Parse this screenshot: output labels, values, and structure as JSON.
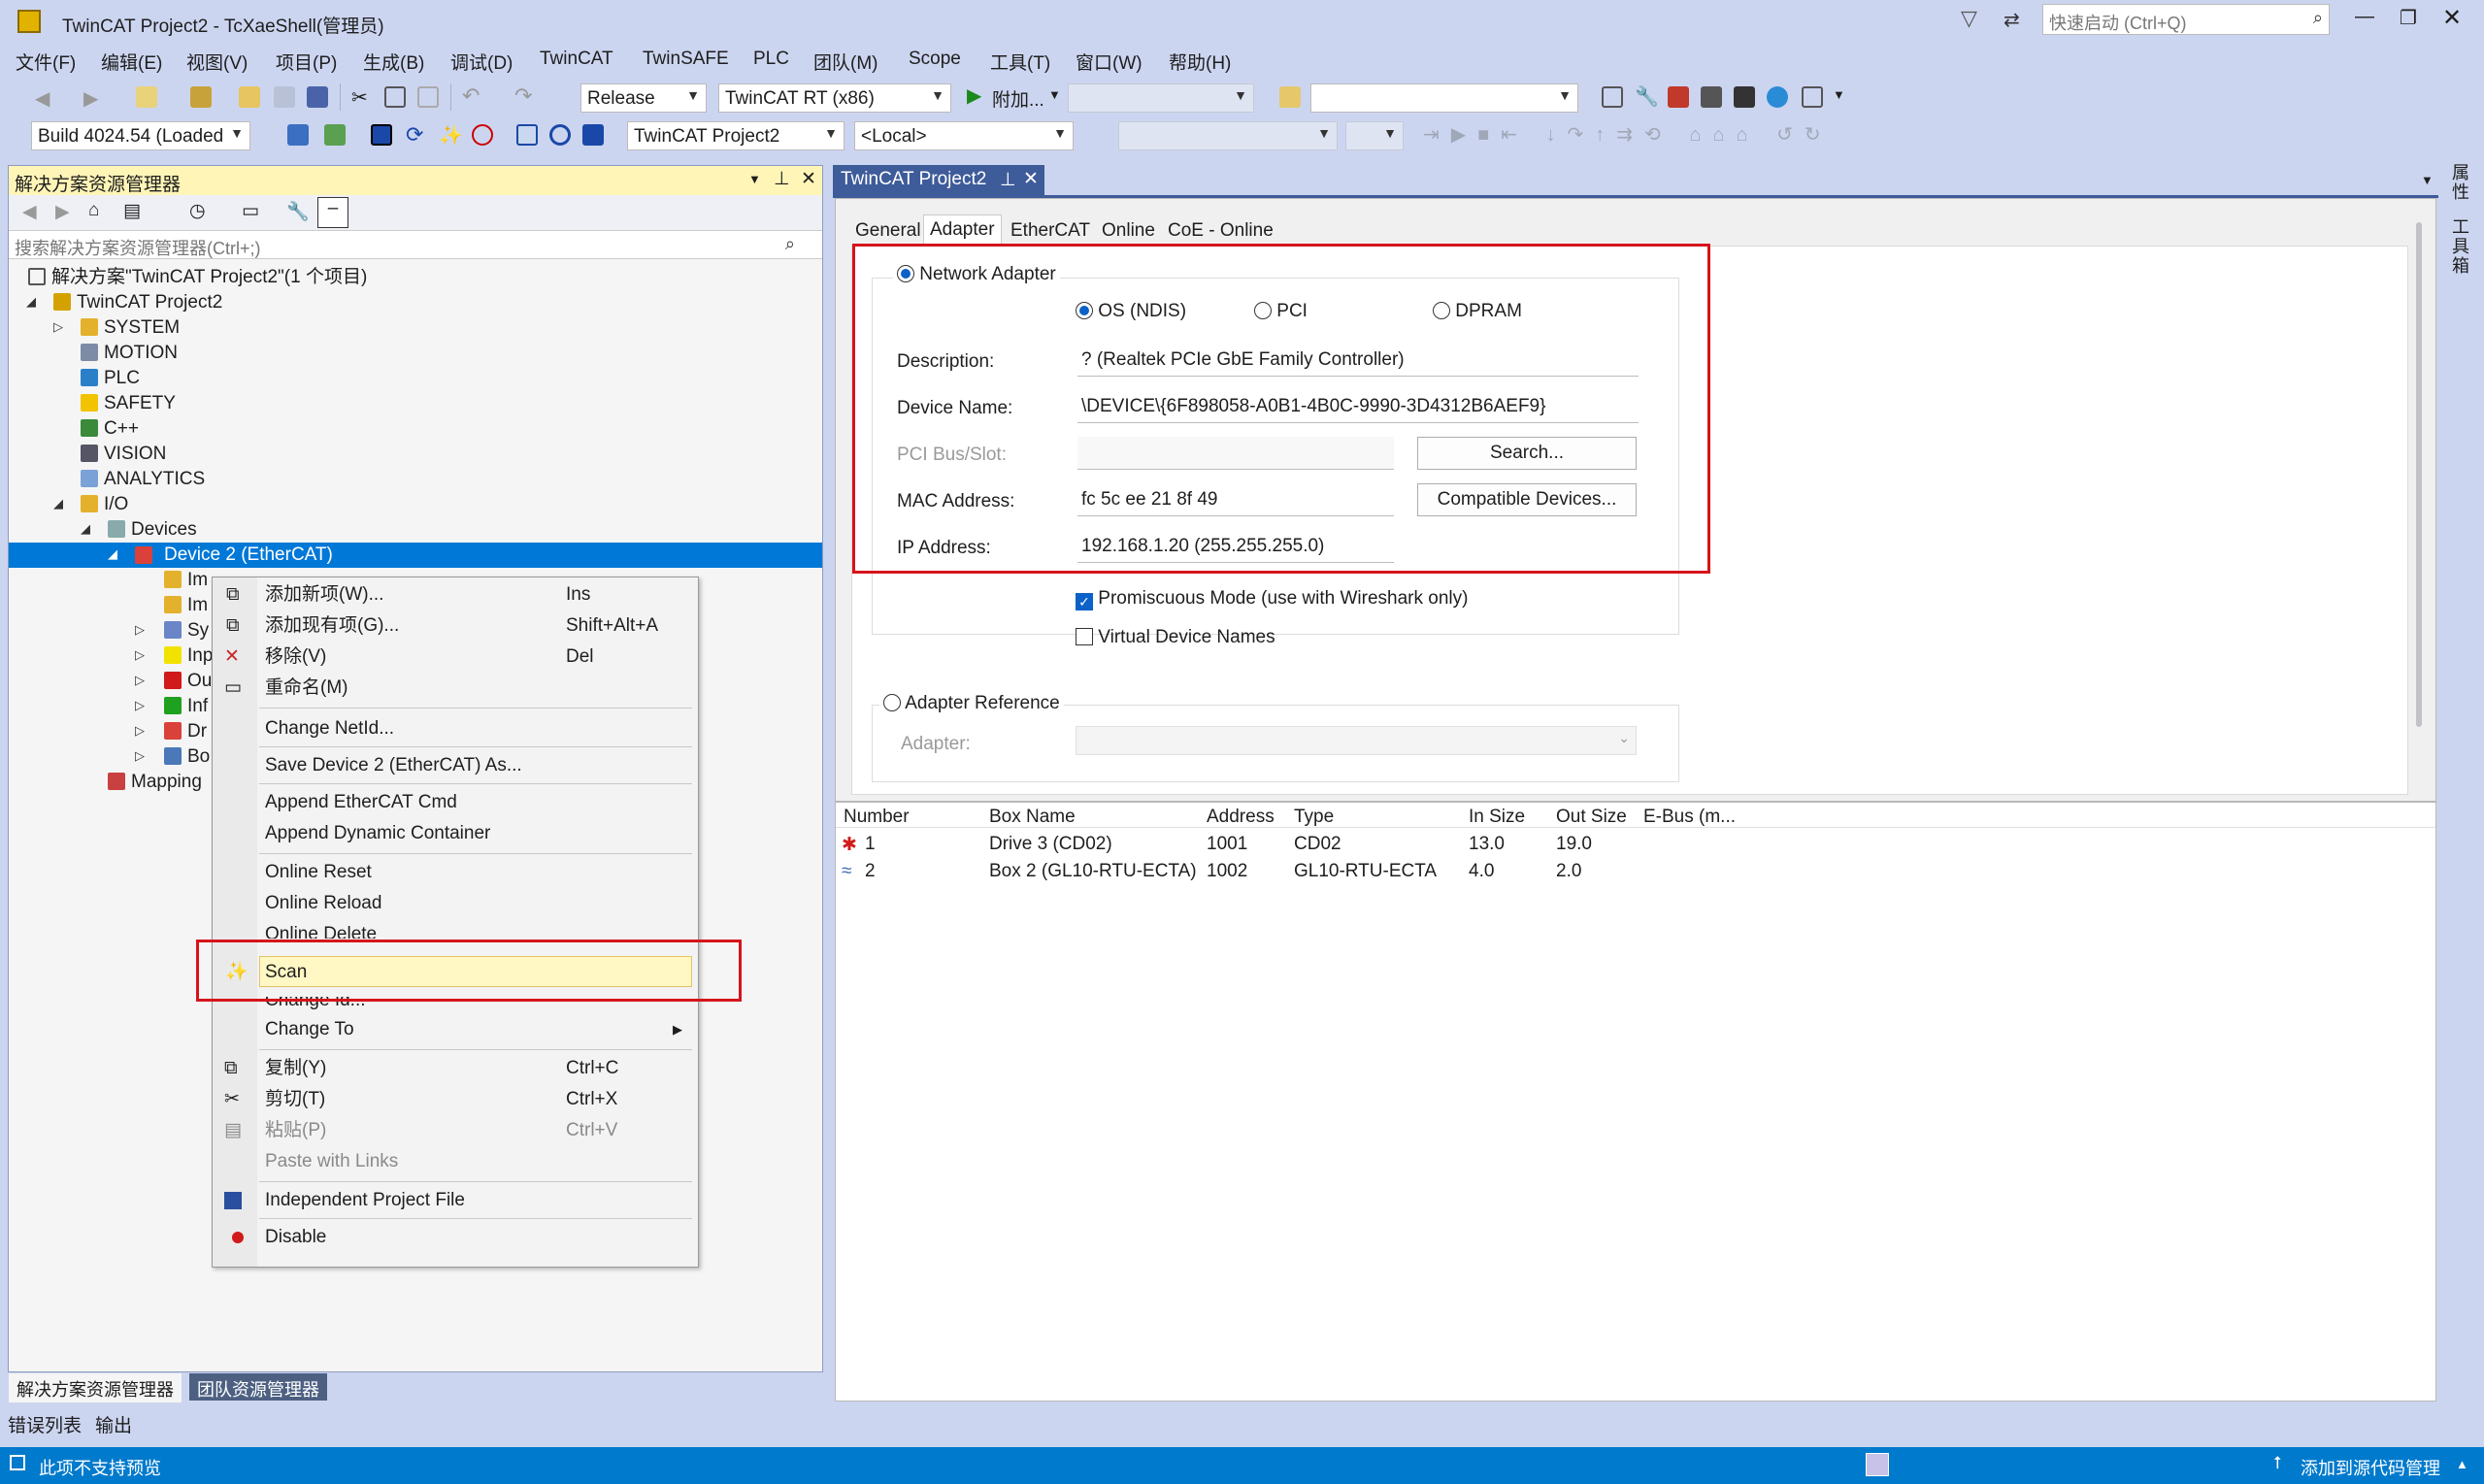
{
  "window": {
    "title": "TwinCAT Project2 - TcXaeShell(管理员)",
    "quick_launch_placeholder": "快速启动 (Ctrl+Q)"
  },
  "menu": [
    "文件(F)",
    "编辑(E)",
    "视图(V)",
    "项目(P)",
    "生成(B)",
    "调试(D)",
    "TwinCAT",
    "TwinSAFE",
    "PLC",
    "团队(M)",
    "Scope",
    "工具(T)",
    "窗口(W)",
    "帮助(H)"
  ],
  "toolbar": {
    "config": "Release",
    "platform": "TwinCAT RT (x86)",
    "attach": "附加...",
    "build": "Build 4024.54 (Loaded",
    "project": "TwinCAT Project2",
    "target": "<Local>"
  },
  "solution_explorer": {
    "title": "解决方案资源管理器",
    "search_placeholder": "搜索解决方案资源管理器(Ctrl+;)",
    "solution": "解决方案\"TwinCAT Project2\"(1 个项目)",
    "project": "TwinCAT Project2",
    "nodes": [
      "SYSTEM",
      "MOTION",
      "PLC",
      "SAFETY",
      "C++",
      "VISION",
      "ANALYTICS",
      "I/O",
      "Devices",
      "Device 2 (EtherCAT)",
      "Im",
      "Im",
      "Sy",
      "Inp",
      "Ou",
      "Inf",
      "Dr",
      "Bo",
      "Mapping"
    ],
    "bottom_tabs": [
      "解决方案资源管理器",
      "团队资源管理器"
    ]
  },
  "context_menu": {
    "items": [
      {
        "label": "添加新项(W)...",
        "shortcut": "Ins"
      },
      {
        "label": "添加现有项(G)...",
        "shortcut": "Shift+Alt+A"
      },
      {
        "label": "移除(V)",
        "shortcut": "Del"
      },
      {
        "label": "重命名(M)",
        "shortcut": ""
      },
      {
        "label": "Change NetId...",
        "shortcut": ""
      },
      {
        "label": "Save Device 2 (EtherCAT) As...",
        "shortcut": ""
      },
      {
        "label": "Append EtherCAT Cmd",
        "shortcut": ""
      },
      {
        "label": "Append Dynamic Container",
        "shortcut": ""
      },
      {
        "label": "Online Reset",
        "shortcut": ""
      },
      {
        "label": "Online Reload",
        "shortcut": ""
      },
      {
        "label": "Online Delete",
        "shortcut": ""
      },
      {
        "label": "Scan",
        "shortcut": ""
      },
      {
        "label": "Change Id...",
        "shortcut": ""
      },
      {
        "label": "Change To",
        "shortcut": ""
      },
      {
        "label": "复制(Y)",
        "shortcut": "Ctrl+C"
      },
      {
        "label": "剪切(T)",
        "shortcut": "Ctrl+X"
      },
      {
        "label": "粘贴(P)",
        "shortcut": "Ctrl+V"
      },
      {
        "label": "Paste with Links",
        "shortcut": ""
      },
      {
        "label": "Independent Project File",
        "shortcut": ""
      },
      {
        "label": "Disable",
        "shortcut": ""
      }
    ]
  },
  "document": {
    "tab": "TwinCAT Project2",
    "subtabs": [
      "General",
      "Adapter",
      "EtherCAT",
      "Online",
      "CoE - Online"
    ],
    "network_adapter": "Network Adapter",
    "modes": [
      "OS (NDIS)",
      "PCI",
      "DPRAM"
    ],
    "description_label": "Description:",
    "description": "? (Realtek PCIe GbE Family Controller)",
    "device_name_label": "Device Name:",
    "device_name": "\\DEVICE\\{6F898058-A0B1-4B0C-9990-3D4312B6AEF9}",
    "pci_label": "PCI Bus/Slot:",
    "search_btn": "Search...",
    "mac_label": "MAC Address:",
    "mac": "fc 5c ee 21 8f 49",
    "compat_btn": "Compatible Devices...",
    "ip_label": "IP Address:",
    "ip": "192.168.1.20 (255.255.255.0)",
    "promiscuous": "Promiscuous Mode (use with Wireshark only)",
    "virtual_names": "Virtual Device Names",
    "adapter_ref": "Adapter Reference",
    "adapter_label": "Adapter:"
  },
  "table": {
    "headers": [
      "Number",
      "Box Name",
      "Address",
      "Type",
      "In Size",
      "Out Size",
      "E-Bus (m..."
    ],
    "rows": [
      [
        "1",
        "Drive 3 (CD02)",
        "1001",
        "CD02",
        "13.0",
        "19.0"
      ],
      [
        "2",
        "Box 2 (GL10-RTU-ECTA)",
        "1002",
        "GL10-RTU-ECTA",
        "4.0",
        "2.0"
      ]
    ]
  },
  "bottom_tabs": [
    "错误列表",
    "输出"
  ],
  "right_rail": [
    "属性",
    "工具箱"
  ],
  "status": {
    "left": "此项不支持预览",
    "right": "添加到源代码管理"
  }
}
